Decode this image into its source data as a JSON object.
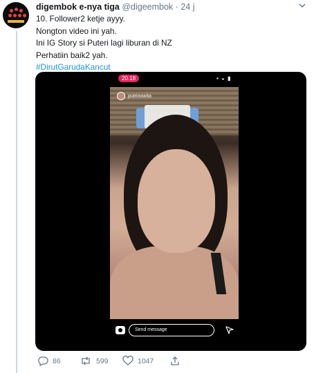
{
  "tweet": {
    "author": {
      "display_name": "digembok e-nya tiga",
      "handle": "@digeembok",
      "separator": "·",
      "time": "24 j"
    },
    "lines": [
      "10. Follower2 ketje ayyy.",
      "Nongton video ini yah.",
      "Ini IG Story si Puteri lagi liburan di NZ",
      "Perhatiin baik2 yah."
    ],
    "hashtag": "#DirutGarudaKancut"
  },
  "media": {
    "status_time": "20.18",
    "story_username": "putrinowita",
    "send_placeholder": "Send message"
  },
  "actions": {
    "replies": "86",
    "retweets": "599",
    "likes": "1047"
  },
  "colors": {
    "hashtag": "#1b95e0",
    "muted": "#657786",
    "status_badge": "#e0245e"
  }
}
